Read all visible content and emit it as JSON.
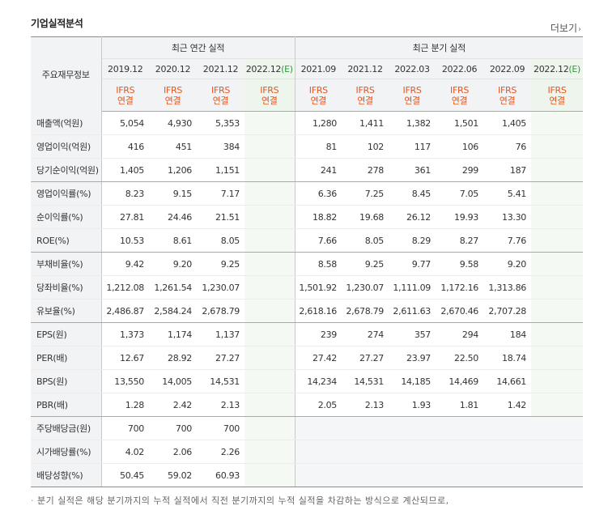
{
  "section_title": "기업실적분석",
  "more_label": "더보기",
  "corner_label": "주요재무정보",
  "groups": {
    "annual": "최근 연간 실적",
    "quarterly": "최근 분기 실적"
  },
  "periods": [
    {
      "label": "2019.12",
      "est": ""
    },
    {
      "label": "2020.12",
      "est": ""
    },
    {
      "label": "2021.12",
      "est": ""
    },
    {
      "label": "2022.12",
      "est": "(E)"
    },
    {
      "label": "2021.09",
      "est": ""
    },
    {
      "label": "2021.12",
      "est": ""
    },
    {
      "label": "2022.03",
      "est": ""
    },
    {
      "label": "2022.06",
      "est": ""
    },
    {
      "label": "2022.09",
      "est": ""
    },
    {
      "label": "2022.12",
      "est": "(E)"
    }
  ],
  "ifrs_line1": "IFRS",
  "ifrs_line2": "연결",
  "rows": [
    {
      "label": "매출액(억원)",
      "values": [
        "5,054",
        "4,930",
        "5,353",
        "",
        "1,280",
        "1,411",
        "1,382",
        "1,501",
        "1,405",
        ""
      ]
    },
    {
      "label": "영업이익(억원)",
      "values": [
        "416",
        "451",
        "384",
        "",
        "81",
        "102",
        "117",
        "106",
        "76",
        ""
      ]
    },
    {
      "label": "당기순이익(억원)",
      "values": [
        "1,405",
        "1,206",
        "1,151",
        "",
        "241",
        "278",
        "361",
        "299",
        "187",
        ""
      ]
    },
    {
      "label": "영업이익률(%)",
      "values": [
        "8.23",
        "9.15",
        "7.17",
        "",
        "6.36",
        "7.25",
        "8.45",
        "7.05",
        "5.41",
        ""
      ]
    },
    {
      "label": "순이익률(%)",
      "values": [
        "27.81",
        "24.46",
        "21.51",
        "",
        "18.82",
        "19.68",
        "26.12",
        "19.93",
        "13.30",
        ""
      ]
    },
    {
      "label": "ROE(%)",
      "values": [
        "10.53",
        "8.61",
        "8.05",
        "",
        "7.66",
        "8.05",
        "8.29",
        "8.27",
        "7.76",
        ""
      ]
    },
    {
      "label": "부채비율(%)",
      "values": [
        "9.42",
        "9.20",
        "9.25",
        "",
        "8.58",
        "9.25",
        "9.77",
        "9.58",
        "9.20",
        ""
      ]
    },
    {
      "label": "당좌비율(%)",
      "values": [
        "1,212.08",
        "1,261.54",
        "1,230.07",
        "",
        "1,501.92",
        "1,230.07",
        "1,111.09",
        "1,172.16",
        "1,313.86",
        ""
      ]
    },
    {
      "label": "유보율(%)",
      "values": [
        "2,486.87",
        "2,584.24",
        "2,678.79",
        "",
        "2,618.16",
        "2,678.79",
        "2,611.63",
        "2,670.46",
        "2,707.28",
        ""
      ]
    },
    {
      "label": "EPS(원)",
      "values": [
        "1,373",
        "1,174",
        "1,137",
        "",
        "239",
        "274",
        "357",
        "294",
        "184",
        ""
      ]
    },
    {
      "label": "PER(배)",
      "values": [
        "12.67",
        "28.92",
        "27.27",
        "",
        "27.42",
        "27.27",
        "23.97",
        "22.50",
        "18.74",
        ""
      ]
    },
    {
      "label": "BPS(원)",
      "values": [
        "13,550",
        "14,005",
        "14,531",
        "",
        "14,234",
        "14,531",
        "14,185",
        "14,469",
        "14,661",
        ""
      ]
    },
    {
      "label": "PBR(배)",
      "values": [
        "1.28",
        "2.42",
        "2.13",
        "",
        "2.05",
        "2.13",
        "1.93",
        "1.81",
        "1.42",
        ""
      ]
    },
    {
      "label": "주당배당금(원)",
      "values": [
        "700",
        "700",
        "700",
        "",
        "",
        "",
        "",
        "",
        "",
        ""
      ],
      "blank_quarterly": true
    },
    {
      "label": "시가배당률(%)",
      "values": [
        "4.02",
        "2.06",
        "2.26",
        "",
        "",
        "",
        "",
        "",
        "",
        ""
      ],
      "blank_quarterly": true
    },
    {
      "label": "배당성향(%)",
      "values": [
        "50.45",
        "59.02",
        "60.93",
        "",
        "",
        "",
        "",
        "",
        "",
        ""
      ],
      "blank_quarterly": true
    }
  ],
  "footnote": "분기 실적은 해당 분기까지의 누적 실적에서 직전 분기까지의 누적 실적을 차감하는 방식으로 계산되므로,",
  "colors": {
    "ifrs": "#e8541c",
    "estimate_tag": "#2f9a3a",
    "estimate_bg": "#f4f9f3",
    "header_bg": "#f2f3f5"
  }
}
